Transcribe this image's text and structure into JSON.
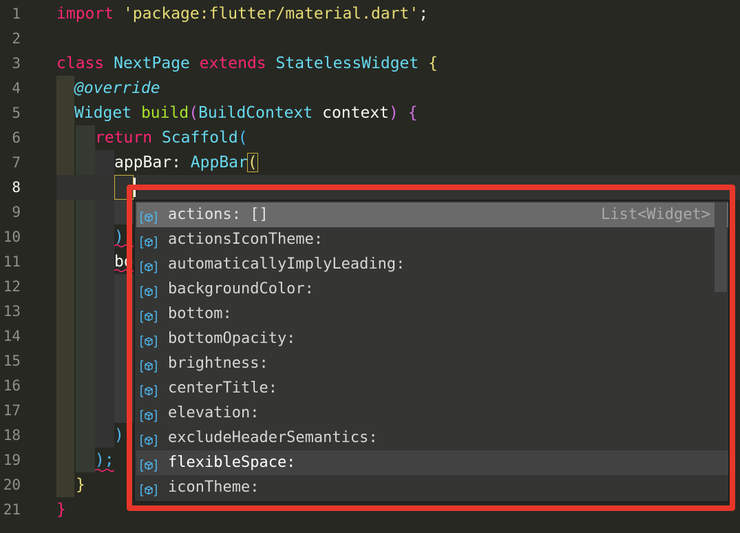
{
  "editor": {
    "line_numbers": [
      "1",
      "2",
      "3",
      "4",
      "5",
      "6",
      "7",
      "8",
      "9",
      "10",
      "11",
      "12",
      "13",
      "14",
      "15",
      "16",
      "17",
      "18",
      "19",
      "20",
      "21"
    ],
    "active_line": "8",
    "code": {
      "l1_kw": "import",
      "l1_str": "'package:flutter/material.dart'",
      "l1_end": ";",
      "l3_kw1": "class",
      "l3_cls1": "NextPage",
      "l3_kw2": "extends",
      "l3_cls2": "StatelessWidget",
      "l3_brace": "{",
      "l4_ann": "@override",
      "l5_type": "Widget",
      "l5_fn": "build",
      "l5_open": "(",
      "l5_ptype": "BuildContext",
      "l5_pname": "context",
      "l5_close": ")",
      "l5_brace": "{",
      "l6_kw": "return",
      "l6_cls": "Scaffold",
      "l6_paren": "(",
      "l7_prop": "appBar:",
      "l7_cls": "AppBar",
      "l7_paren": "(",
      "l10_frag": ")",
      "l11_frag": "bo",
      "l18_frag": ")",
      "l19_frag": ");",
      "l20_brace": "}",
      "l21_brace": "}"
    }
  },
  "suggestions": {
    "items": [
      {
        "label": "actions: []",
        "detail": "List<Widget>"
      },
      {
        "label": "actionsIconTheme:"
      },
      {
        "label": "automaticallyImplyLeading:"
      },
      {
        "label": "backgroundColor:"
      },
      {
        "label": "bottom:"
      },
      {
        "label": "bottomOpacity:"
      },
      {
        "label": "brightness:"
      },
      {
        "label": "centerTitle:"
      },
      {
        "label": "elevation:"
      },
      {
        "label": "excludeHeaderSemantics:"
      },
      {
        "label": "flexibleSpace:"
      },
      {
        "label": "iconTheme:"
      }
    ],
    "icon": "field-cube-icon",
    "icon_color": "#4fb7f0"
  },
  "colors": {
    "background": "#272822",
    "keyword": "#f92672",
    "string": "#e6db74",
    "class": "#66d9ef",
    "function": "#a6e22e",
    "highlight_frame": "#e8372a"
  }
}
